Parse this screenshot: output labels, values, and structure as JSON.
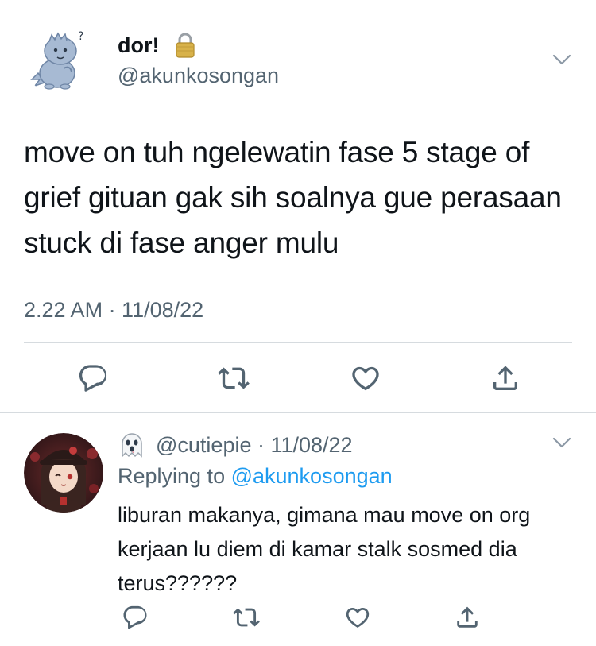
{
  "main_tweet": {
    "display_name": "dor!",
    "handle": "@akunkosongan",
    "text": "move on tuh ngelewatin fase 5 stage of grief gituan gak sih soalnya gue perasaan stuck di fase anger mulu",
    "timestamp": "2.22 AM · 11/08/22",
    "icons": {
      "avatar": "dinosaur-avatar",
      "lock": "lock-icon",
      "more": "chevron-down-icon"
    }
  },
  "actions": {
    "reply": "reply-icon",
    "retweet": "retweet-icon",
    "like": "heart-icon",
    "share": "share-icon"
  },
  "reply_tweet": {
    "emoji": "ghost-icon",
    "meta": "@cutiepie · 11/08/22",
    "replying_prefix": "Replying to ",
    "replying_handle": "@akunkosongan",
    "text": "liburan makanya, gimana mau move on org kerjaan lu diem di kamar stalk sosmed dia terus??????",
    "icons": {
      "avatar": "anime-avatar",
      "more": "chevron-down-icon"
    }
  },
  "colors": {
    "text_primary": "#0f1419",
    "text_secondary": "#536471",
    "link": "#1d9bf0",
    "divider": "#d6dbdf"
  }
}
